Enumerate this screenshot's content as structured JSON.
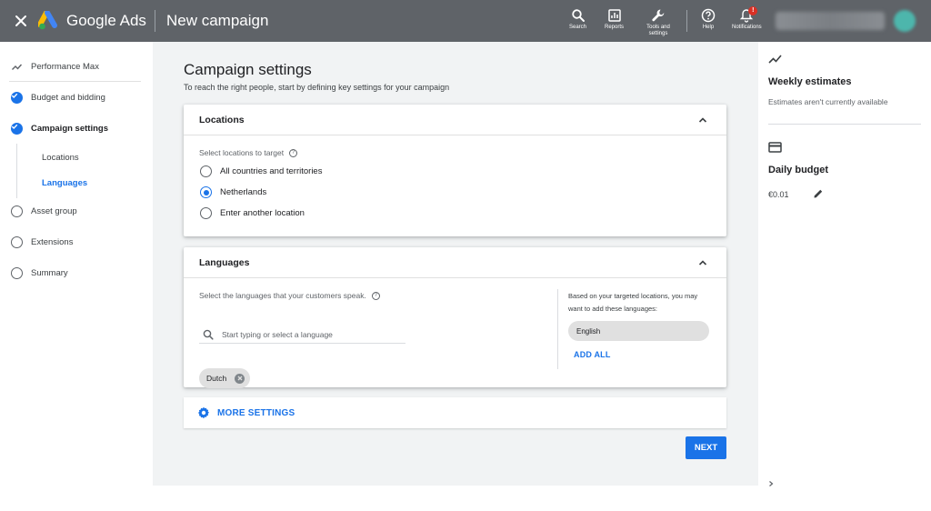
{
  "topbar": {
    "brand": "Google Ads",
    "page_title": "New campaign",
    "tools": [
      {
        "label": "Search",
        "icon": "search-icon"
      },
      {
        "label": "Reports",
        "icon": "reports-icon"
      },
      {
        "label": "Tools and settings",
        "icon": "wrench-icon"
      },
      {
        "label": "Help",
        "icon": "help-icon"
      },
      {
        "label": "Notifications",
        "icon": "bell-icon"
      }
    ],
    "notification_badge": "!",
    "colors": {
      "bar": "#5f6368"
    }
  },
  "leftnav": {
    "items": [
      {
        "label": "Performance Max",
        "state": "type"
      },
      {
        "label": "Budget and bidding",
        "state": "done"
      },
      {
        "label": "Campaign settings",
        "state": "current"
      },
      {
        "label": "Asset group",
        "state": "todo"
      },
      {
        "label": "Extensions",
        "state": "todo"
      },
      {
        "label": "Summary",
        "state": "todo"
      }
    ],
    "subitems": [
      {
        "label": "Locations",
        "active": false
      },
      {
        "label": "Languages",
        "active": true
      }
    ]
  },
  "main": {
    "title": "Campaign settings",
    "subtitle": "To reach the right people, start by defining key settings for your campaign",
    "locations": {
      "heading": "Locations",
      "field_label": "Select locations to target",
      "options": [
        {
          "label": "All countries and territories",
          "selected": false
        },
        {
          "label": "Netherlands",
          "selected": true
        },
        {
          "label": "Enter another location",
          "selected": false
        }
      ]
    },
    "languages": {
      "heading": "Languages",
      "field_label": "Select the languages that your customers speak.",
      "search_placeholder": "Start typing or select a language",
      "selected_chip": "Dutch",
      "suggestion_text": "Based on your targeted locations, you may want to add these languages:",
      "suggestion_chip": "English",
      "add_all": "ADD ALL"
    },
    "more_settings": "MORE SETTINGS",
    "next": "NEXT",
    "colors": {
      "accent": "#1a73e8",
      "background": "#f1f3f4"
    }
  },
  "rightpanel": {
    "weekly_title": "Weekly estimates",
    "weekly_sub": "Estimates aren't currently available",
    "budget_title": "Daily budget",
    "budget_value": "€0.01"
  }
}
